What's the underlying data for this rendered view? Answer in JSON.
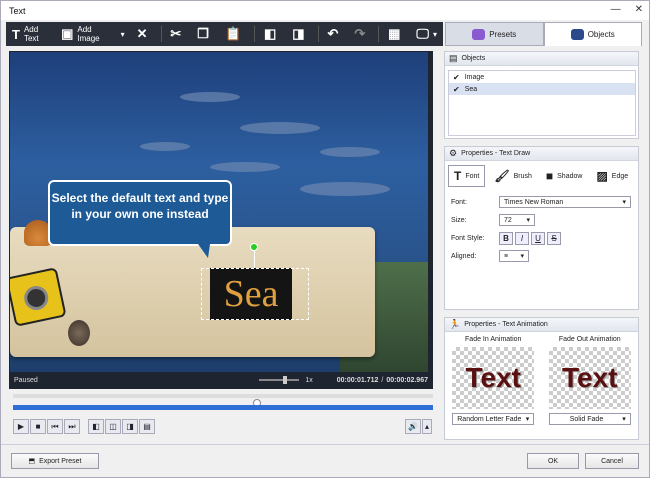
{
  "window": {
    "title": "Text"
  },
  "toolbar": {
    "add_text": "Add Text",
    "add_image": "Add Image"
  },
  "tabs": {
    "presets": "Presets",
    "objects": "Objects"
  },
  "preview": {
    "callout_text": "Select the default text and type in your own one instead",
    "sample_text": "Sea",
    "status": "Paused",
    "speed": "1x",
    "time_current": "00:00:01.712",
    "time_separator": "/",
    "time_total": "00:00:02.967"
  },
  "objects_panel": {
    "title": "Objects",
    "items": [
      {
        "label": "Image",
        "checked": true
      },
      {
        "label": "Sea",
        "checked": true
      }
    ]
  },
  "text_draw": {
    "title": "Properties - Text Draw",
    "tabs": {
      "font": "Font",
      "brush": "Brush",
      "shadow": "Shadow",
      "edge": "Edge"
    },
    "font_label": "Font:",
    "font_value": "Times New Roman",
    "size_label": "Size:",
    "size_value": "72",
    "style_label": "Font Style:",
    "style_buttons": {
      "bold": "B",
      "italic": "I",
      "underline": "U",
      "strike": "S"
    },
    "aligned_label": "Aligned:"
  },
  "text_animation": {
    "title": "Properties - Text Animation",
    "fade_in_label": "Fade In Animation",
    "fade_out_label": "Fade Out Animation",
    "preview_text": "Text",
    "fade_in_value": "Random Letter Fade",
    "fade_out_value": "Solid Fade"
  },
  "footer": {
    "export": "Export Preset",
    "ok": "OK",
    "cancel": "Cancel"
  }
}
